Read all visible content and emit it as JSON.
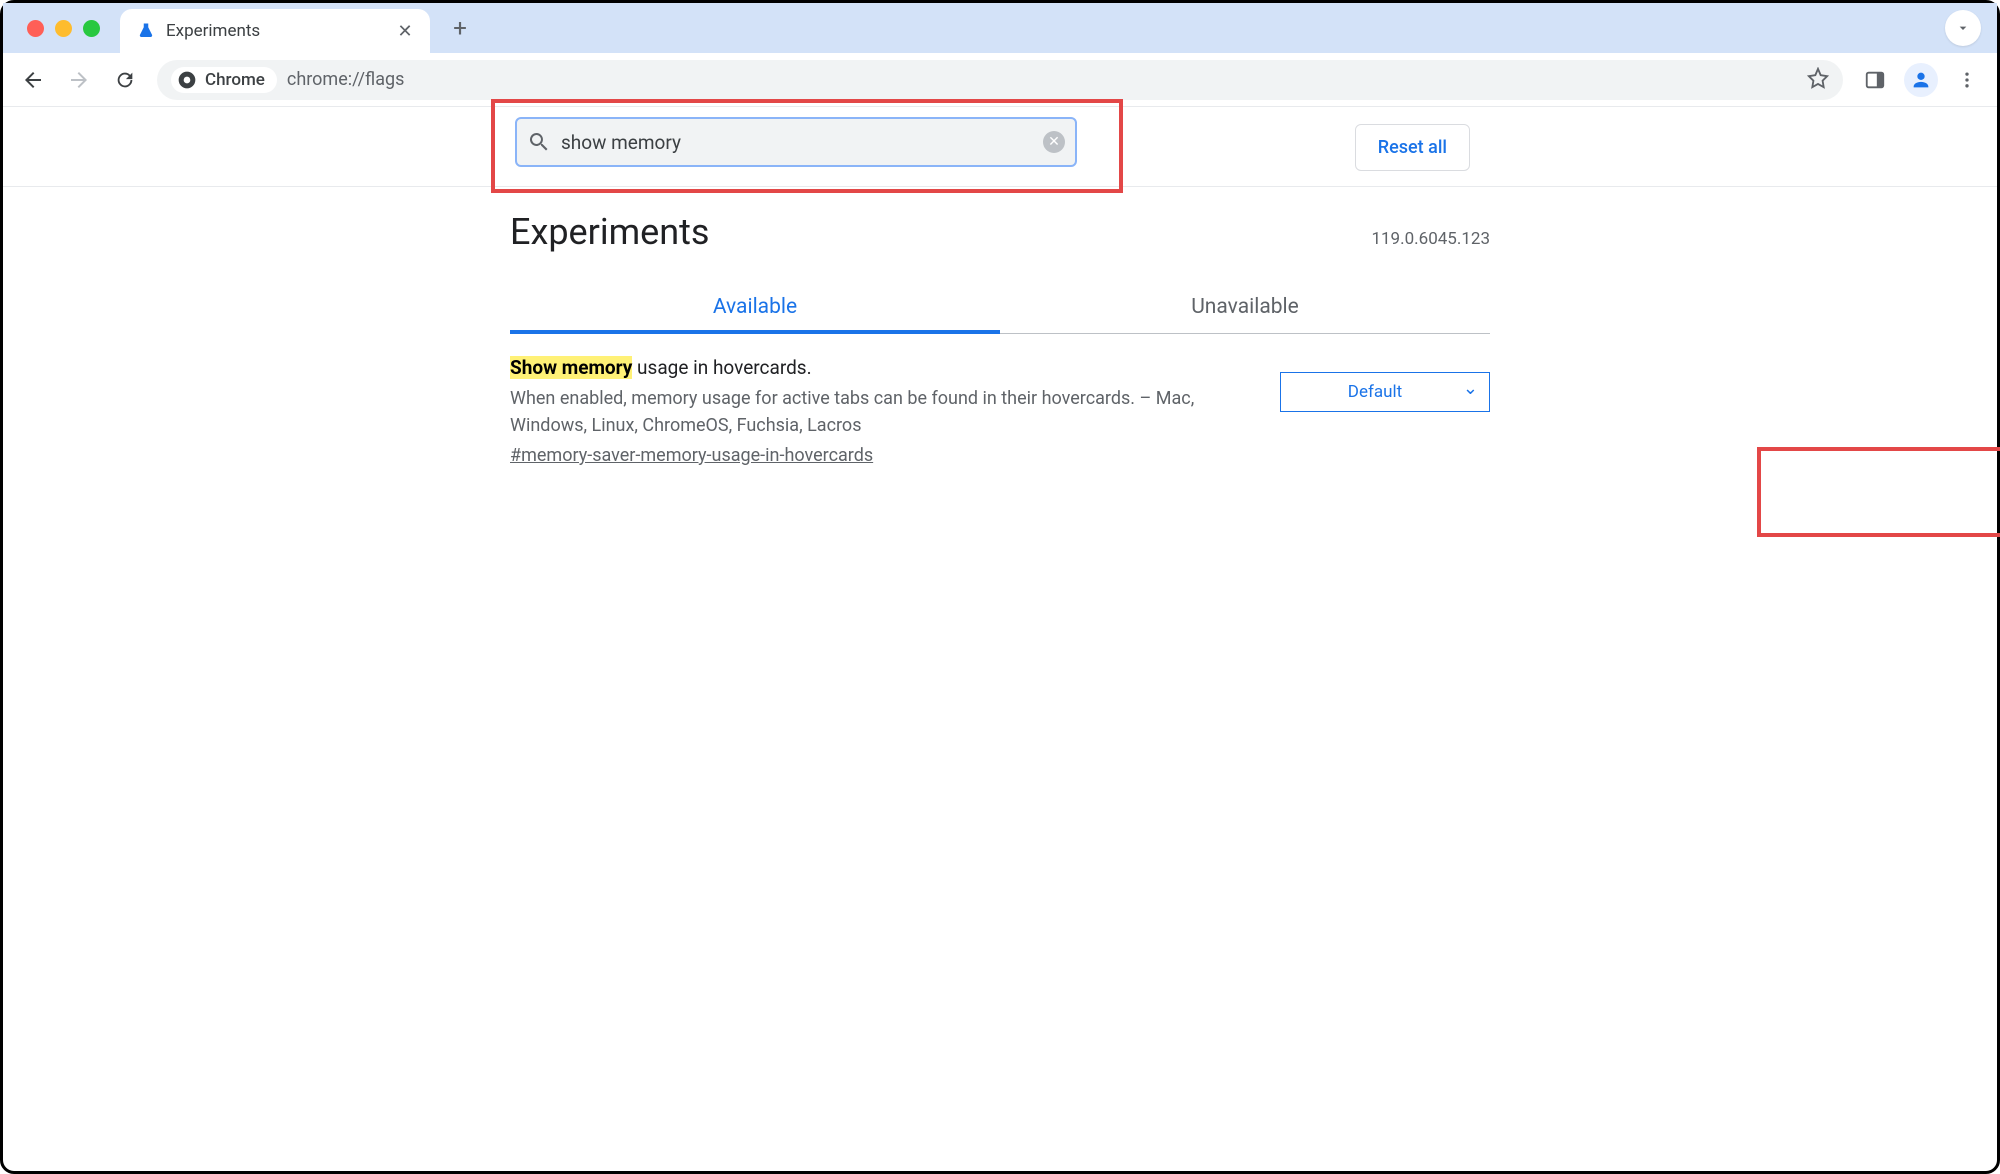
{
  "browser": {
    "tab_title": "Experiments",
    "url": "chrome://flags",
    "omnibox_chip": "Chrome"
  },
  "searchbar": {
    "value": "show memory",
    "reset_label": "Reset all"
  },
  "header": {
    "title": "Experiments",
    "version": "119.0.6045.123"
  },
  "tabs": {
    "available": "Available",
    "unavailable": "Unavailable"
  },
  "flag": {
    "title_highlight": "Show memory",
    "title_rest": " usage in hovercards.",
    "description": "When enabled, memory usage for active tabs can be found in their hovercards. – Mac, Windows, Linux, ChromeOS, Fuchsia, Lacros",
    "hash": "#memory-saver-memory-usage-in-hovercards",
    "select_value": "Default"
  }
}
